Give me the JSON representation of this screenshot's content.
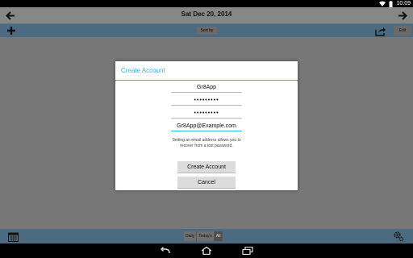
{
  "status_bar": {
    "time": "10:09"
  },
  "date_header": {
    "title": "Sat Dec 20, 2014"
  },
  "toolbar": {
    "sort_label": "Sort by",
    "edit_label": "Edit"
  },
  "dialog": {
    "title": "Create Account",
    "username_value": "Gr8App",
    "password_value": "•••••••••",
    "confirm_password_value": "•••••••••",
    "email_value": "Gr8App@Example.com",
    "hint_text": "Setting an email address allows you to recover from a lost password.",
    "create_button_label": "Create Account",
    "cancel_button_label": "Cancel"
  },
  "bottom_bar": {
    "segments": [
      "Daily",
      "Today's",
      "All"
    ],
    "active_segment": "All"
  },
  "icons": {
    "back": "arrow-left-icon",
    "forward": "arrow-right-icon",
    "add": "plus-icon",
    "share": "share-icon",
    "calendar": "calendar-icon",
    "settings": "gear-icon",
    "wifi": "wifi-icon",
    "battery": "battery-icon",
    "nav_back": "nav-back-icon",
    "nav_home": "nav-home-icon",
    "nav_recents": "nav-recents-icon"
  },
  "colors": {
    "accent": "#33b5e5",
    "toolbar": "#4d6b80",
    "background": "#777777"
  }
}
